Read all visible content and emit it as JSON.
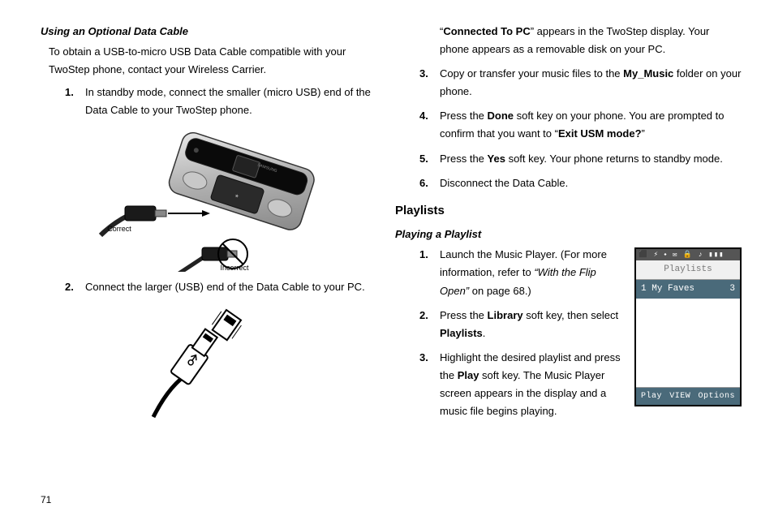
{
  "page_number": "71",
  "left": {
    "subhead": "Using an Optional Data Cable",
    "intro": "To obtain a USB-to-micro USB Data Cable compatible with your TwoStep phone, contact your Wireless Carrier.",
    "step1": "In standby mode, connect the smaller (micro USB) end of the Data Cable to your TwoStep phone.",
    "step2": "Connect the larger (USB) end of the Data Cable to your PC.",
    "correct_label": "Correct",
    "incorrect_label": "Incorrect"
  },
  "right": {
    "cont_pre": "“",
    "cont_bold": "Connected To PC",
    "cont_post": "” appears in the TwoStep display. Your phone appears as a removable disk on your PC.",
    "step3_a": "Copy or transfer your music files to the ",
    "step3_b": "My_Music",
    "step3_c": " folder on your phone.",
    "step4_a": "Press the ",
    "step4_b": "Done",
    "step4_c": " soft key on your phone. You are prompted to confirm that you want to “",
    "step4_d": "Exit USM mode?",
    "step4_e": "”",
    "step5_a": "Press the ",
    "step5_b": "Yes",
    "step5_c": " soft key. Your phone returns to standby mode.",
    "step6": "Disconnect the Data Cable.",
    "playlists_head": "Playlists",
    "playing_subhead": "Playing a Playlist",
    "p1_a": "Launch the Music Player. (For more information, refer to ",
    "p1_b": "“With the Flip Open”",
    "p1_c": "  on page 68.)",
    "p2_a": "Press the ",
    "p2_b": "Library",
    "p2_c": " soft key, then select ",
    "p2_d": "Playlists",
    "p2_e": ".",
    "p3_a": "Highlight the desired playlist and press the ",
    "p3_b": "Play",
    "p3_c": " soft key. The Music Player screen appears in the display and a music file begins playing.",
    "shot": {
      "status": "⬛  ⚡ ⬩ ✉  🔒 ♪ ▮▮▮",
      "title": "Playlists",
      "row_n": "1",
      "row_label": "My Faves",
      "row_count": "3",
      "soft_left": "Play",
      "soft_center": "VIEW",
      "soft_right": "Options"
    }
  }
}
